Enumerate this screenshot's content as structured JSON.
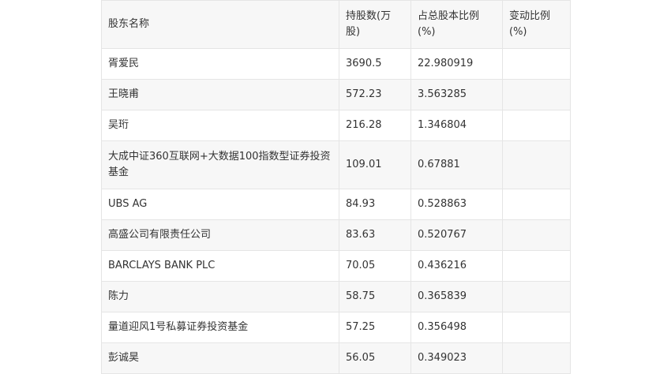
{
  "table": {
    "headers": [
      "股东名称",
      "持股数(万股)",
      "占总股本比例(%)",
      "变动比例(%)"
    ],
    "rows": [
      [
        "胥爱民",
        "3690.5",
        "22.980919",
        ""
      ],
      [
        "王晓甫",
        "572.23",
        "3.563285",
        ""
      ],
      [
        "吴珩",
        "216.28",
        "1.346804",
        ""
      ],
      [
        "大成中证360互联网+大数据100指数型证券投资基金",
        "109.01",
        "0.67881",
        ""
      ],
      [
        "UBS AG",
        "84.93",
        "0.528863",
        ""
      ],
      [
        "高盛公司有限责任公司",
        "83.63",
        "0.520767",
        ""
      ],
      [
        "BARCLAYS BANK PLC",
        "70.05",
        "0.436216",
        ""
      ],
      [
        "陈力",
        "58.75",
        "0.365839",
        ""
      ],
      [
        "量道迎风1号私募证券投资基金",
        "57.25",
        "0.356498",
        ""
      ],
      [
        "彭诚昊",
        "56.05",
        "0.349023",
        ""
      ]
    ]
  }
}
